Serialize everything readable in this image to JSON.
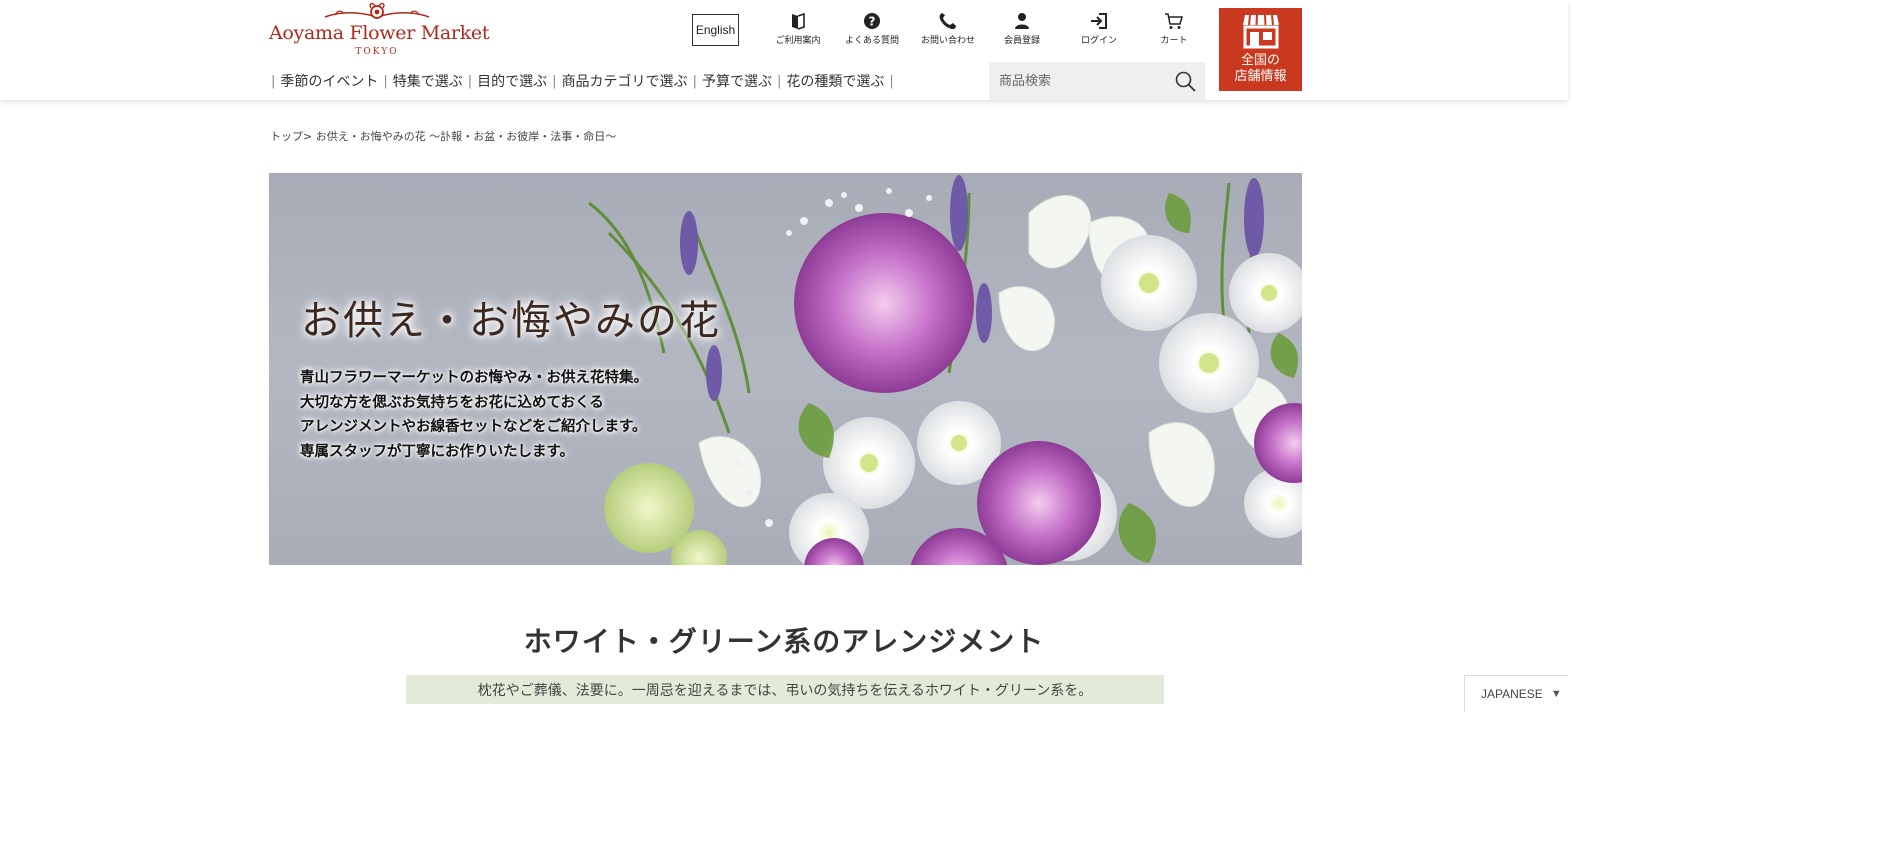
{
  "logo": {
    "name": "Aoyama Flower Market",
    "sub": "TOKYO"
  },
  "header": {
    "english_label": "English",
    "utility": [
      {
        "label": "ご利用案内",
        "icon": "guide-icon"
      },
      {
        "label": "よくある質問",
        "icon": "question-icon"
      },
      {
        "label": "お問い合わせ",
        "icon": "phone-icon"
      },
      {
        "label": "会員登録",
        "icon": "member-icon"
      },
      {
        "label": "ログイン",
        "icon": "login-icon"
      },
      {
        "label": "カート",
        "icon": "cart-icon"
      }
    ],
    "store_label": "全国の\n店舗情報",
    "colors": {
      "brand": "#b02a1a",
      "store_bg": "#c8391f",
      "search_bg": "#efefef"
    }
  },
  "nav": {
    "items": [
      "季節のイベント",
      "特集で選ぶ",
      "目的で選ぶ",
      "商品カテゴリで選ぶ",
      "予算で選ぶ",
      "花の種類で選ぶ"
    ],
    "separator": "|"
  },
  "search": {
    "placeholder": "商品検索"
  },
  "breadcrumb": {
    "text": "トップ> お供え・お悔やみの花 〜訃報・お盆・お彼岸・法事・命日〜"
  },
  "hero": {
    "title": "お供え・お悔やみの花",
    "lines": [
      "青山フラワーマーケットのお悔やみ・お供え花特集。",
      "大切な方を偲ぶお気持ちをお花に込めておくる",
      "アレンジメントやお線香セットなどをご紹介します。",
      "専属スタッフが丁寧にお作りいたします。"
    ]
  },
  "section": {
    "title": "ホワイト・グリーン系のアレンジメント",
    "subtitle": "枕花やご葬儀、法要に。一周忌を迎えるまでは、弔いの気持ちを伝えるホワイト・グリーン系を。",
    "subtitle_bg": "#e3ebd8"
  },
  "language_selector": {
    "label": "JAPANESE",
    "caret": "▼"
  }
}
